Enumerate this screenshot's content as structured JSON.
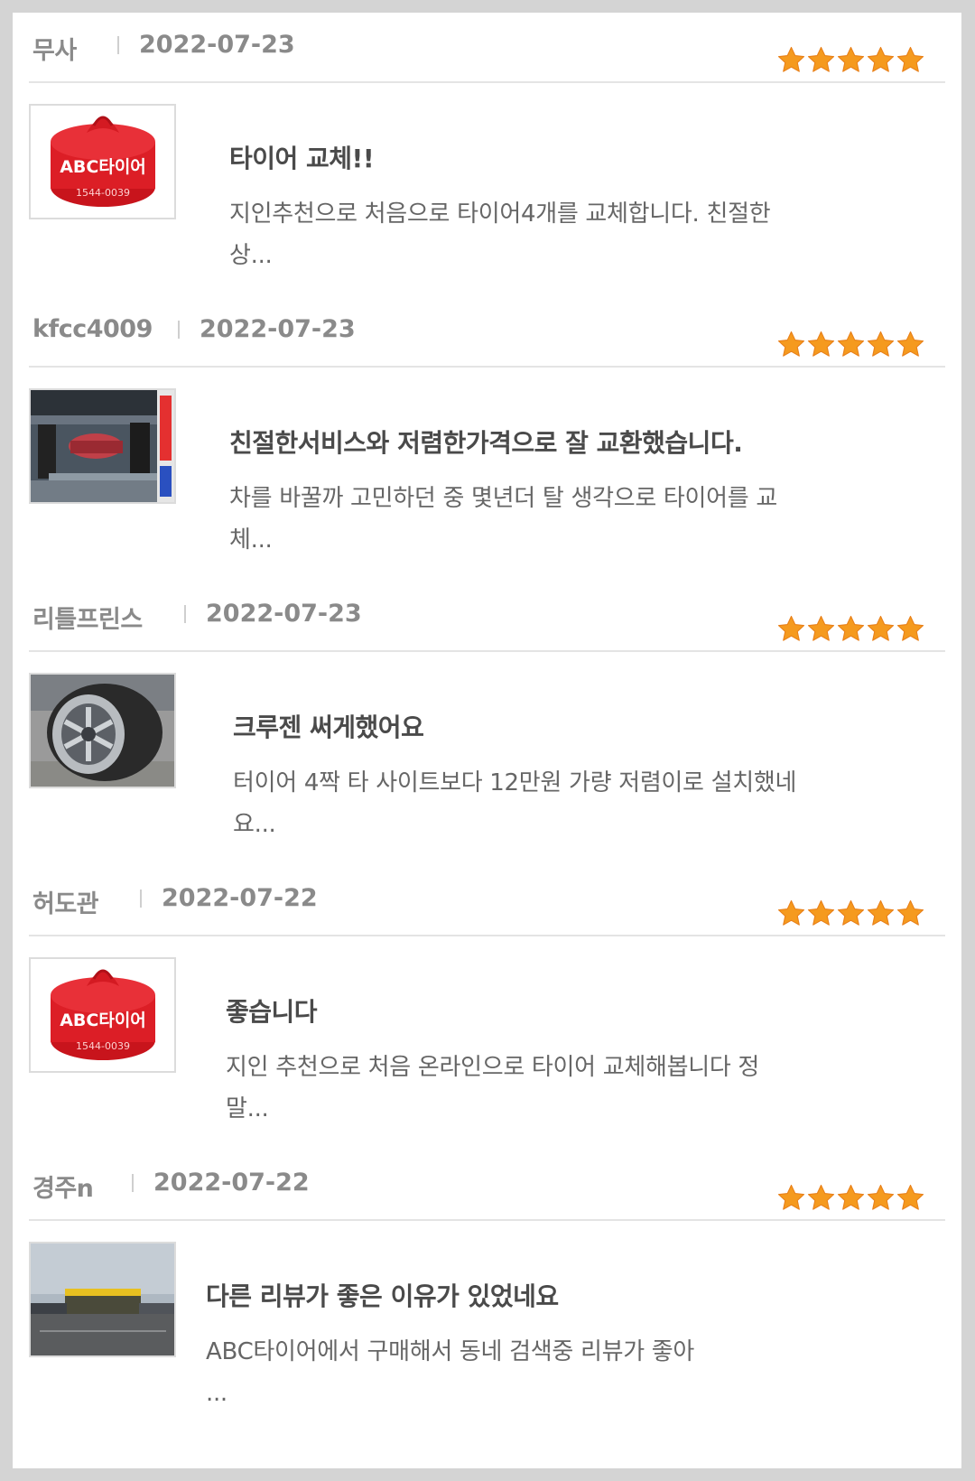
{
  "reviews": [
    {
      "author": "무사",
      "date": "2022-07-23",
      "rating": 5,
      "title": "타이어 교체!!",
      "excerpt": "지인추천으로 처음으로 타이어4개를 교체합니다. 친절한 상...",
      "image": "abc-tire-bag-photo",
      "image_text": {
        "brand": "ABC타이어",
        "phone": "1544-0039"
      }
    },
    {
      "author": "kfcc4009",
      "date": "2022-07-23",
      "rating": 5,
      "title": "친절한서비스와 저렴한가격으로 잘 교환했습니다.",
      "excerpt": "차를 바꿀까 고민하던 중 몇년더 탈 생각으로 타이어를 교체...",
      "image": "garage-car-lift-photo"
    },
    {
      "author": "리틀프린스",
      "date": "2022-07-23",
      "rating": 5,
      "title": "크루젠 써게했어요",
      "excerpt": "터이어 4짝 타 사이트보다 12만원 가량 저렴이로 설치했네요...",
      "image": "car-wheel-tire-photo"
    },
    {
      "author": "허도관",
      "date": "2022-07-22",
      "rating": 5,
      "title": "좋습니다",
      "excerpt": "지인 추천으로 처음 온라인으로 타이어 교체해봅니다 정말...",
      "image": "abc-tire-bag-photo",
      "image_text": {
        "brand": "ABC타이어",
        "phone": "1544-0039"
      }
    },
    {
      "author": "경주n",
      "date": "2022-07-22",
      "rating": 5,
      "title": "다른 리뷰가 좋은 이유가 있었네요",
      "excerpt": "ABC타이어에서 구매해서 동네 검색중 리뷰가 좋아 ...",
      "image": "tire-shop-exterior-photo"
    }
  ],
  "colors": {
    "star": "#f59a1e",
    "star_stroke": "#e8801a",
    "meta_text": "#8a8a8a",
    "divider": "#e4e4e4"
  }
}
